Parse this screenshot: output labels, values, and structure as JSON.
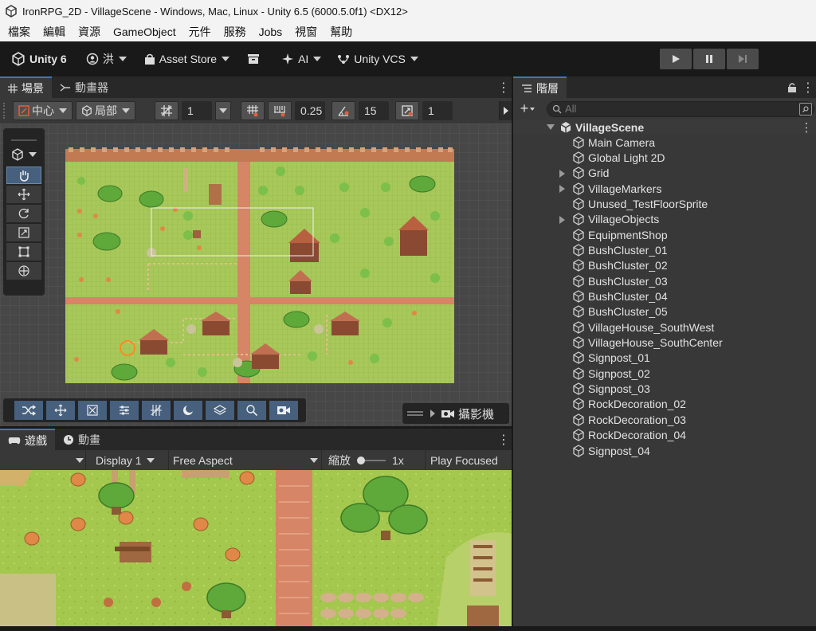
{
  "window": {
    "title": "IronRPG_2D - VillageScene - Windows, Mac, Linux - Unity 6.5 (6000.5.0f1) <DX12>"
  },
  "menu": [
    "檔案",
    "編輯",
    "資源",
    "GameObject",
    "元件",
    "服務",
    "Jobs",
    "視窗",
    "幫助"
  ],
  "toolbar": {
    "unity_label": "Unity 6",
    "account_label": "洪",
    "asset_store_label": "Asset Store",
    "ai_label": "AI",
    "vcs_label": "Unity VCS"
  },
  "scene_panel": {
    "tabs": [
      "場景",
      "動畫器"
    ],
    "pivot_label": "中心",
    "space_label": "局部",
    "grid_size": "1",
    "snap_increment": "0.25",
    "rotate_snap": "15",
    "scale_snap": "1",
    "camera_label": "攝影機"
  },
  "game_panel": {
    "tabs": [
      "遊戲",
      "動畫"
    ],
    "display": "Display 1",
    "aspect": "Free Aspect",
    "scale_label": "縮放",
    "scale_value": "1x",
    "play_focused": "Play Focused"
  },
  "hierarchy": {
    "tab_label": "階層",
    "search_placeholder": "All",
    "scene_name": "VillageScene",
    "items": [
      {
        "label": "Main Camera",
        "expandable": false
      },
      {
        "label": "Global Light 2D",
        "expandable": false
      },
      {
        "label": "Grid",
        "expandable": true
      },
      {
        "label": "VillageMarkers",
        "expandable": true
      },
      {
        "label": "Unused_TestFloorSprite",
        "expandable": false
      },
      {
        "label": "VillageObjects",
        "expandable": true
      },
      {
        "label": "EquipmentShop",
        "expandable": false
      },
      {
        "label": "BushCluster_01",
        "expandable": false
      },
      {
        "label": "BushCluster_02",
        "expandable": false
      },
      {
        "label": "BushCluster_03",
        "expandable": false
      },
      {
        "label": "BushCluster_04",
        "expandable": false
      },
      {
        "label": "BushCluster_05",
        "expandable": false
      },
      {
        "label": "VillageHouse_SouthWest",
        "expandable": false
      },
      {
        "label": "VillageHouse_SouthCenter",
        "expandable": false
      },
      {
        "label": "Signpost_01",
        "expandable": false
      },
      {
        "label": "Signpost_02",
        "expandable": false
      },
      {
        "label": "Signpost_03",
        "expandable": false
      },
      {
        "label": "RockDecoration_02",
        "expandable": false
      },
      {
        "label": "RockDecoration_03",
        "expandable": false
      },
      {
        "label": "RockDecoration_04",
        "expandable": false
      },
      {
        "label": "Signpost_04",
        "expandable": false
      }
    ]
  },
  "colors": {
    "grass": "#a4c84e",
    "path": "#d98a6a",
    "tree": "#5fa83a",
    "roof": "#b86040",
    "accent": "#3a79bb"
  }
}
